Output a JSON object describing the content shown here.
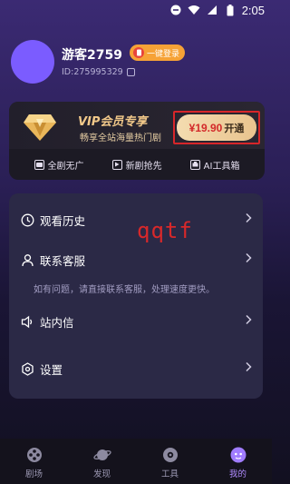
{
  "status_bar": {
    "time": "2:05"
  },
  "profile": {
    "username": "游客2759",
    "login_chip_label": "一键登录",
    "user_id": "ID:275995329"
  },
  "vip": {
    "title": "VIP会员专享",
    "subtitle": "畅享全站海量热门剧",
    "price": "¥19.90",
    "open_label": "开通",
    "perks": [
      {
        "label": "全剧无广",
        "icon": "ad-free-icon"
      },
      {
        "label": "新剧抢先",
        "icon": "play-icon"
      },
      {
        "label": "AI工具箱",
        "icon": "ai-toolbox-icon"
      }
    ]
  },
  "menu": {
    "items": [
      {
        "label": "观看历史",
        "icon": "history-clock-icon"
      },
      {
        "label": "联系客服",
        "icon": "user-icon"
      },
      {
        "label": "站内信",
        "icon": "speaker-icon"
      },
      {
        "label": "设置",
        "icon": "settings-icon"
      }
    ],
    "service_note": "如有问题，请直接联系客服，处理速度更快。"
  },
  "watermark": "qqtf",
  "tabbar": {
    "tabs": [
      {
        "label": "剧场",
        "icon": "film-reel-icon",
        "active": false
      },
      {
        "label": "发现",
        "icon": "planet-icon",
        "active": false
      },
      {
        "label": "工具",
        "icon": "tool-gear-icon",
        "active": false
      },
      {
        "label": "我的",
        "icon": "profile-face-icon",
        "active": true
      }
    ]
  },
  "colors": {
    "accent": "#b08bff",
    "avatar": "#7b5cff",
    "price": "#d32a2a",
    "highlight_box": "#d7262a"
  }
}
